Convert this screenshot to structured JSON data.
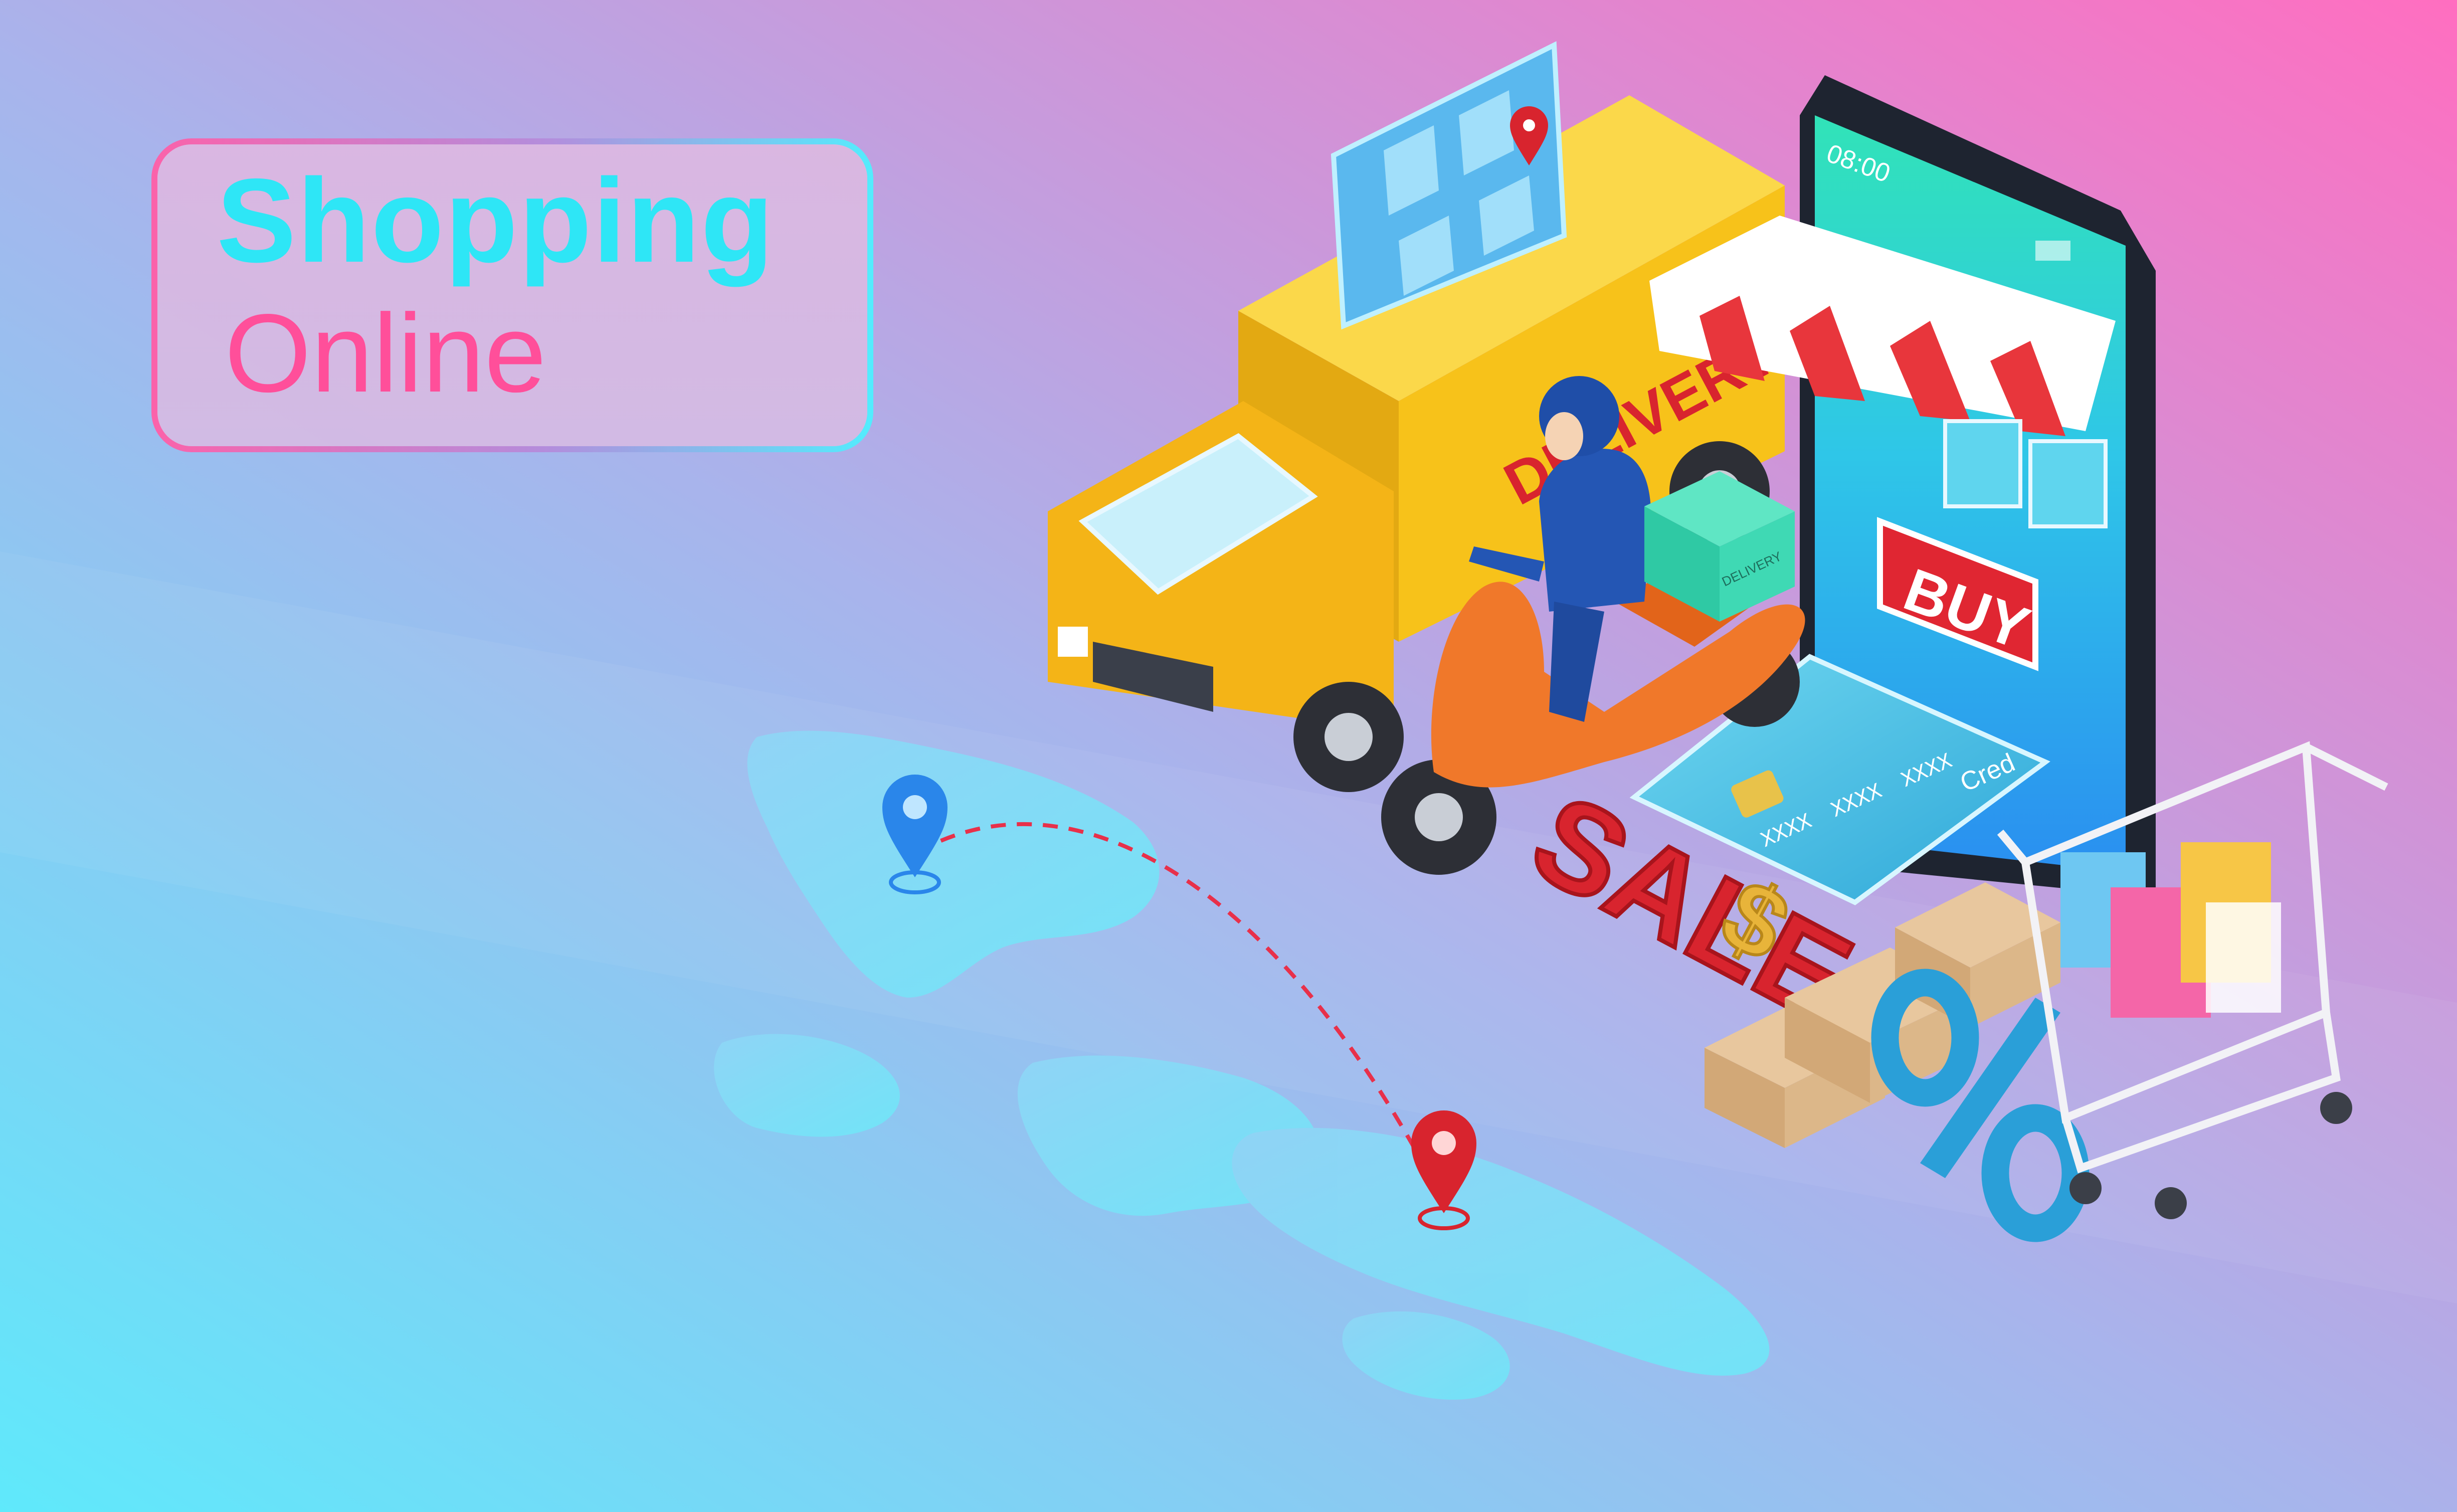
{
  "title": {
    "line1": "Shopping",
    "line2": "Online"
  },
  "phone": {
    "time": "08:00",
    "buy_label": "BUY"
  },
  "truck": {
    "side_text": "DELIVERY"
  },
  "box": {
    "label": "DELIVERY"
  },
  "card": {
    "number_groups": [
      "XXXX",
      "XXXX",
      "XXXX",
      "XXXX"
    ],
    "label": "Cred"
  },
  "sale": {
    "text": "SALE",
    "currency_symbol": "$",
    "percent_symbol": "%"
  },
  "colors": {
    "background_top_right": "#ff6ec0",
    "background_bottom_left": "#5fe9fb",
    "title_cyan": "#2ee6f6",
    "title_pink": "#ff4f9a",
    "truck_yellow": "#f7c21a",
    "scooter_orange": "#f0782a",
    "sale_red": "#d8242e",
    "map_cyan": "#7fe4f6"
  },
  "icons": [
    "map-pin-blue-icon",
    "map-pin-red-icon",
    "location-marker-icon",
    "shopping-cart-icon"
  ]
}
